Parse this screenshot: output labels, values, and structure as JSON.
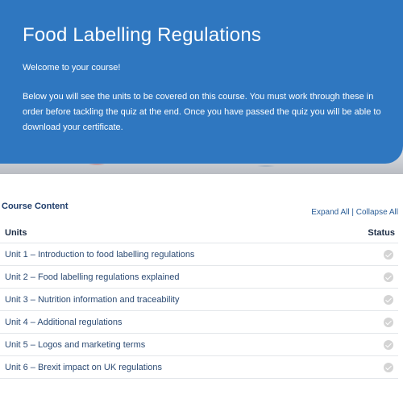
{
  "hero": {
    "title": "Food Labelling Regulations",
    "welcome": "Welcome to your course!",
    "description": "Below you will see the units to be covered on this course. You must work through these in order before tackling the quiz at the end. Once you have passed the quiz you will be able to download your certificate."
  },
  "content": {
    "heading": "Course Content",
    "expand_all": "Expand All",
    "separator": "|",
    "collapse_all": "Collapse All",
    "columns": {
      "units": "Units",
      "status": "Status"
    },
    "units": [
      {
        "label": "Unit 1 – Introduction to food labelling regulations",
        "status": "not-completed-check-icon"
      },
      {
        "label": "Unit 2 – Food labelling regulations explained",
        "status": "not-completed-check-icon"
      },
      {
        "label": "Unit 3 – Nutrition information and traceability",
        "status": "not-completed-check-icon"
      },
      {
        "label": "Unit 4 – Additional regulations",
        "status": "not-completed-check-icon"
      },
      {
        "label": "Unit 5 – Logos and marketing terms",
        "status": "not-completed-check-icon"
      },
      {
        "label": "Unit 6 – Brexit impact on UK regulations",
        "status": "not-completed-check-icon"
      }
    ]
  },
  "colors": {
    "hero_blue": "#2f77c0",
    "link": "#2a5d96",
    "status_grey": "#d4d4d4"
  }
}
